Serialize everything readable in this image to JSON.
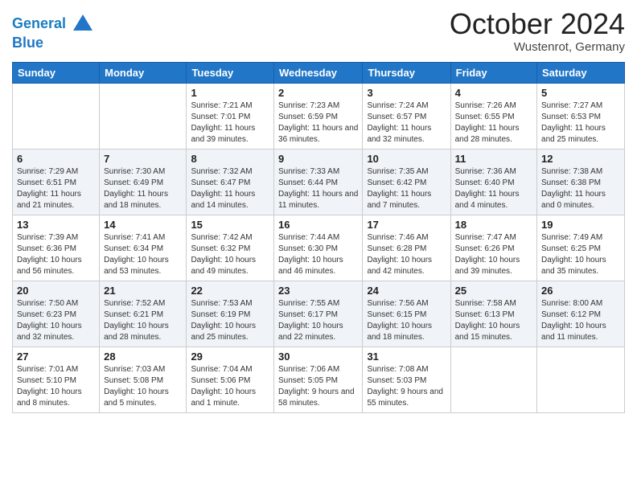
{
  "header": {
    "logo_line1": "General",
    "logo_line2": "Blue",
    "month": "October 2024",
    "location": "Wustenrot, Germany"
  },
  "weekdays": [
    "Sunday",
    "Monday",
    "Tuesday",
    "Wednesday",
    "Thursday",
    "Friday",
    "Saturday"
  ],
  "weeks": [
    [
      {
        "day": "",
        "info": ""
      },
      {
        "day": "",
        "info": ""
      },
      {
        "day": "1",
        "info": "Sunrise: 7:21 AM\nSunset: 7:01 PM\nDaylight: 11 hours and 39 minutes."
      },
      {
        "day": "2",
        "info": "Sunrise: 7:23 AM\nSunset: 6:59 PM\nDaylight: 11 hours and 36 minutes."
      },
      {
        "day": "3",
        "info": "Sunrise: 7:24 AM\nSunset: 6:57 PM\nDaylight: 11 hours and 32 minutes."
      },
      {
        "day": "4",
        "info": "Sunrise: 7:26 AM\nSunset: 6:55 PM\nDaylight: 11 hours and 28 minutes."
      },
      {
        "day": "5",
        "info": "Sunrise: 7:27 AM\nSunset: 6:53 PM\nDaylight: 11 hours and 25 minutes."
      }
    ],
    [
      {
        "day": "6",
        "info": "Sunrise: 7:29 AM\nSunset: 6:51 PM\nDaylight: 11 hours and 21 minutes."
      },
      {
        "day": "7",
        "info": "Sunrise: 7:30 AM\nSunset: 6:49 PM\nDaylight: 11 hours and 18 minutes."
      },
      {
        "day": "8",
        "info": "Sunrise: 7:32 AM\nSunset: 6:47 PM\nDaylight: 11 hours and 14 minutes."
      },
      {
        "day": "9",
        "info": "Sunrise: 7:33 AM\nSunset: 6:44 PM\nDaylight: 11 hours and 11 minutes."
      },
      {
        "day": "10",
        "info": "Sunrise: 7:35 AM\nSunset: 6:42 PM\nDaylight: 11 hours and 7 minutes."
      },
      {
        "day": "11",
        "info": "Sunrise: 7:36 AM\nSunset: 6:40 PM\nDaylight: 11 hours and 4 minutes."
      },
      {
        "day": "12",
        "info": "Sunrise: 7:38 AM\nSunset: 6:38 PM\nDaylight: 11 hours and 0 minutes."
      }
    ],
    [
      {
        "day": "13",
        "info": "Sunrise: 7:39 AM\nSunset: 6:36 PM\nDaylight: 10 hours and 56 minutes."
      },
      {
        "day": "14",
        "info": "Sunrise: 7:41 AM\nSunset: 6:34 PM\nDaylight: 10 hours and 53 minutes."
      },
      {
        "day": "15",
        "info": "Sunrise: 7:42 AM\nSunset: 6:32 PM\nDaylight: 10 hours and 49 minutes."
      },
      {
        "day": "16",
        "info": "Sunrise: 7:44 AM\nSunset: 6:30 PM\nDaylight: 10 hours and 46 minutes."
      },
      {
        "day": "17",
        "info": "Sunrise: 7:46 AM\nSunset: 6:28 PM\nDaylight: 10 hours and 42 minutes."
      },
      {
        "day": "18",
        "info": "Sunrise: 7:47 AM\nSunset: 6:26 PM\nDaylight: 10 hours and 39 minutes."
      },
      {
        "day": "19",
        "info": "Sunrise: 7:49 AM\nSunset: 6:25 PM\nDaylight: 10 hours and 35 minutes."
      }
    ],
    [
      {
        "day": "20",
        "info": "Sunrise: 7:50 AM\nSunset: 6:23 PM\nDaylight: 10 hours and 32 minutes."
      },
      {
        "day": "21",
        "info": "Sunrise: 7:52 AM\nSunset: 6:21 PM\nDaylight: 10 hours and 28 minutes."
      },
      {
        "day": "22",
        "info": "Sunrise: 7:53 AM\nSunset: 6:19 PM\nDaylight: 10 hours and 25 minutes."
      },
      {
        "day": "23",
        "info": "Sunrise: 7:55 AM\nSunset: 6:17 PM\nDaylight: 10 hours and 22 minutes."
      },
      {
        "day": "24",
        "info": "Sunrise: 7:56 AM\nSunset: 6:15 PM\nDaylight: 10 hours and 18 minutes."
      },
      {
        "day": "25",
        "info": "Sunrise: 7:58 AM\nSunset: 6:13 PM\nDaylight: 10 hours and 15 minutes."
      },
      {
        "day": "26",
        "info": "Sunrise: 8:00 AM\nSunset: 6:12 PM\nDaylight: 10 hours and 11 minutes."
      }
    ],
    [
      {
        "day": "27",
        "info": "Sunrise: 7:01 AM\nSunset: 5:10 PM\nDaylight: 10 hours and 8 minutes."
      },
      {
        "day": "28",
        "info": "Sunrise: 7:03 AM\nSunset: 5:08 PM\nDaylight: 10 hours and 5 minutes."
      },
      {
        "day": "29",
        "info": "Sunrise: 7:04 AM\nSunset: 5:06 PM\nDaylight: 10 hours and 1 minute."
      },
      {
        "day": "30",
        "info": "Sunrise: 7:06 AM\nSunset: 5:05 PM\nDaylight: 9 hours and 58 minutes."
      },
      {
        "day": "31",
        "info": "Sunrise: 7:08 AM\nSunset: 5:03 PM\nDaylight: 9 hours and 55 minutes."
      },
      {
        "day": "",
        "info": ""
      },
      {
        "day": "",
        "info": ""
      }
    ]
  ]
}
